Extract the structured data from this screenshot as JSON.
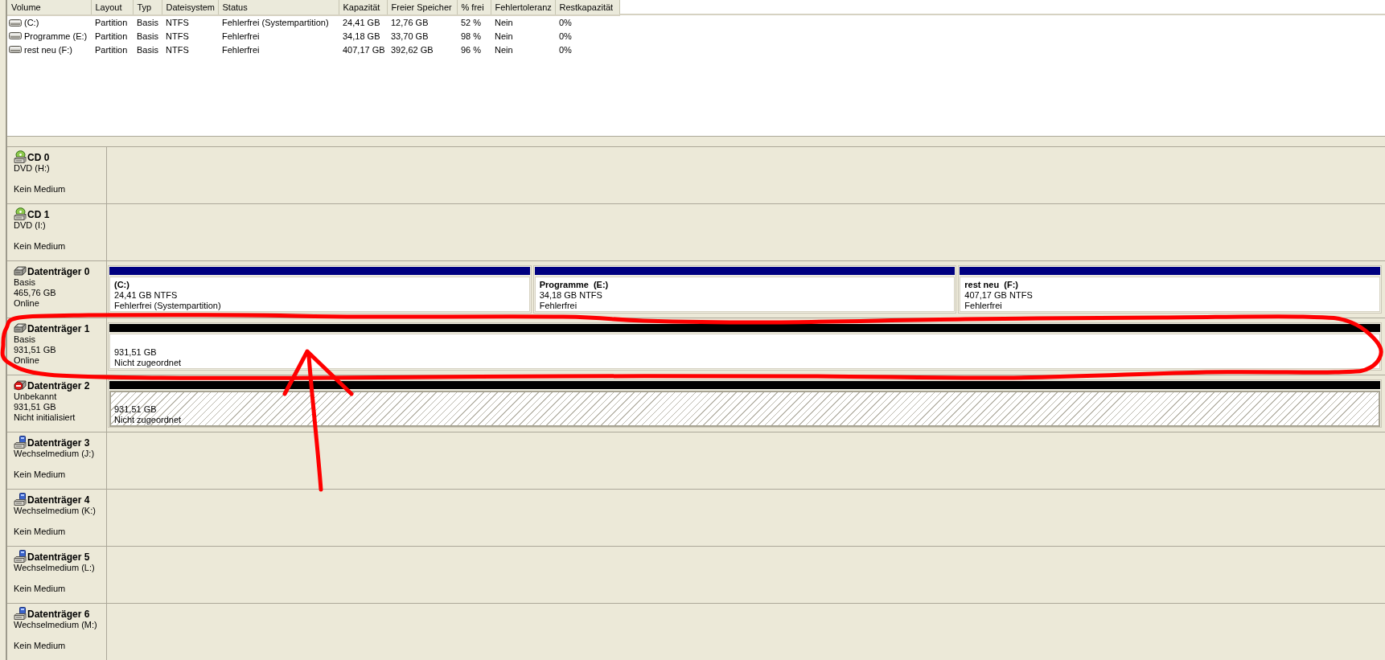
{
  "volume_list": {
    "columns": [
      "Volume",
      "Layout",
      "Typ",
      "Dateisystem",
      "Status",
      "Kapazität",
      "Freier Speicher",
      "% frei",
      "Fehlertoleranz",
      "Restkapazität"
    ],
    "rows": [
      {
        "cells": [
          "(C:)",
          "Partition",
          "Basis",
          "NTFS",
          "Fehlerfrei (Systempartition)",
          "24,41 GB",
          "12,76 GB",
          "52 %",
          "Nein",
          "0%"
        ]
      },
      {
        "cells": [
          "Programme (E:)",
          "Partition",
          "Basis",
          "NTFS",
          "Fehlerfrei",
          "34,18 GB",
          "33,70 GB",
          "98 %",
          "Nein",
          "0%"
        ]
      },
      {
        "cells": [
          "rest neu (F:)",
          "Partition",
          "Basis",
          "NTFS",
          "Fehlerfrei",
          "407,17 GB",
          "392,62 GB",
          "96 %",
          "Nein",
          "0%"
        ]
      }
    ]
  },
  "disks": [
    {
      "kind": "cd",
      "name": "CD 0",
      "type": "DVD (H:)",
      "status": "Kein Medium",
      "circled": false,
      "arrow": false
    },
    {
      "kind": "cd",
      "name": "CD 1",
      "type": "DVD (I:)",
      "status": "Kein Medium",
      "circled": false,
      "arrow": false
    },
    {
      "kind": "disk",
      "name": "Datenträger 0",
      "type": "Basis",
      "size": "465,76 GB",
      "status": "Online",
      "circled": false,
      "arrow": false,
      "partitions": [
        {
          "kind": "primary",
          "name": "(C:)",
          "size": "24,41 GB NTFS",
          "status": "Fehlerfrei (Systempartition)",
          "selected": false
        },
        {
          "kind": "primary",
          "name": "Programme  (E:)",
          "size": "34,18 GB NTFS",
          "status": "Fehlerfrei",
          "selected": false
        },
        {
          "kind": "primary",
          "name": "rest neu  (F:)",
          "size": "407,17 GB NTFS",
          "status": "Fehlerfrei",
          "selected": false
        }
      ]
    },
    {
      "kind": "disk",
      "name": "Datenträger 1",
      "type": "Basis",
      "size": "931,51 GB",
      "status": "Online",
      "circled": true,
      "arrow": true,
      "partitions": [
        {
          "kind": "unallocated",
          "size": "931,51 GB",
          "status": "Nicht zugeordnet",
          "selected": false
        }
      ]
    },
    {
      "kind": "uninitialized",
      "name": "Datenträger 2",
      "type": "Unbekannt",
      "size": "931,51 GB",
      "status": "Nicht initialisiert",
      "circled": false,
      "arrow": false,
      "partitions": [
        {
          "kind": "unallocated",
          "size": "931,51 GB",
          "status": "Nicht zugeordnet",
          "selected": true
        }
      ]
    },
    {
      "kind": "removable",
      "name": "Datenträger 3",
      "type": "Wechselmedium (J:)",
      "status": "Kein Medium",
      "circled": false,
      "arrow": false
    },
    {
      "kind": "removable",
      "name": "Datenträger 4",
      "type": "Wechselmedium (K:)",
      "status": "Kein Medium",
      "circled": false,
      "arrow": false
    },
    {
      "kind": "removable",
      "name": "Datenträger 5",
      "type": "Wechselmedium (L:)",
      "status": "Kein Medium",
      "circled": false,
      "arrow": false
    },
    {
      "kind": "removable",
      "name": "Datenträger 6",
      "type": "Wechselmedium (M:)",
      "status": "Kein Medium",
      "circled": false,
      "arrow": false
    }
  ]
}
